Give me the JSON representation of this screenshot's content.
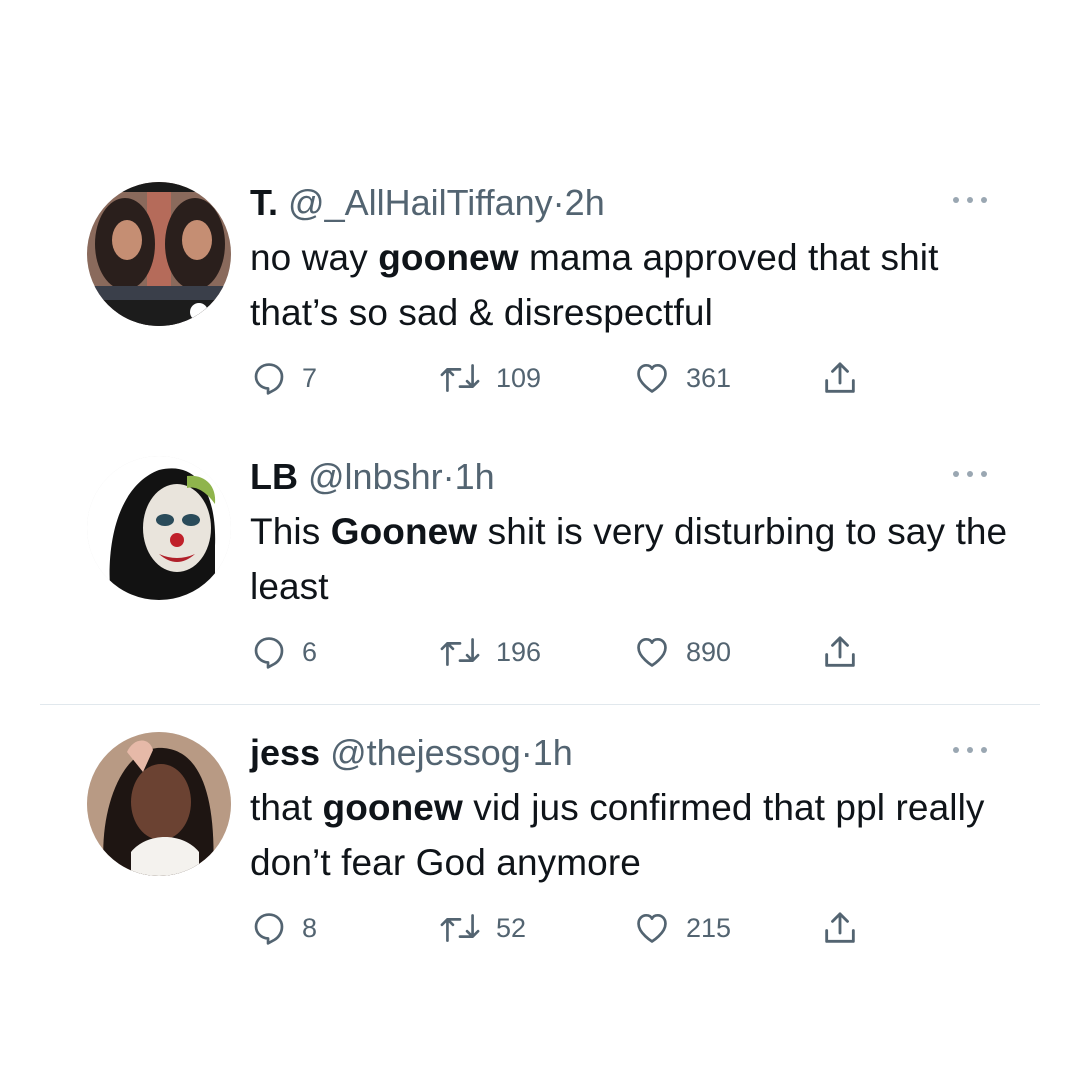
{
  "tweets": [
    {
      "name": "T.",
      "handle": "@_AllHailTiffany",
      "dot": "·",
      "time": "2h",
      "text_parts": [
        "no way ",
        "goonew",
        " mama approved that shit that’s so sad & disrespectful"
      ],
      "replies": "7",
      "retweets": "109",
      "likes": "361"
    },
    {
      "name": "LB",
      "handle": "@lnbshr",
      "dot": "·",
      "time": "1h",
      "text_parts": [
        "This ",
        "Goonew",
        " shit is very disturbing to say the least"
      ],
      "replies": "6",
      "retweets": "196",
      "likes": "890"
    },
    {
      "name": "jess",
      "handle": "@thejessog",
      "dot": "·",
      "time": "1h",
      "text_parts": [
        "that ",
        "goonew",
        " vid jus confirmed that ppl really don’t fear God anymore"
      ],
      "replies": "8",
      "retweets": "52",
      "likes": "215"
    }
  ],
  "icons": {
    "reply": "reply-icon",
    "retweet": "retweet-icon",
    "like": "heart-icon",
    "share": "share-icon",
    "more": "more-icon"
  },
  "colors": {
    "text": "#0f1419",
    "secondary": "#536471",
    "divider": "#e1e8ed"
  }
}
